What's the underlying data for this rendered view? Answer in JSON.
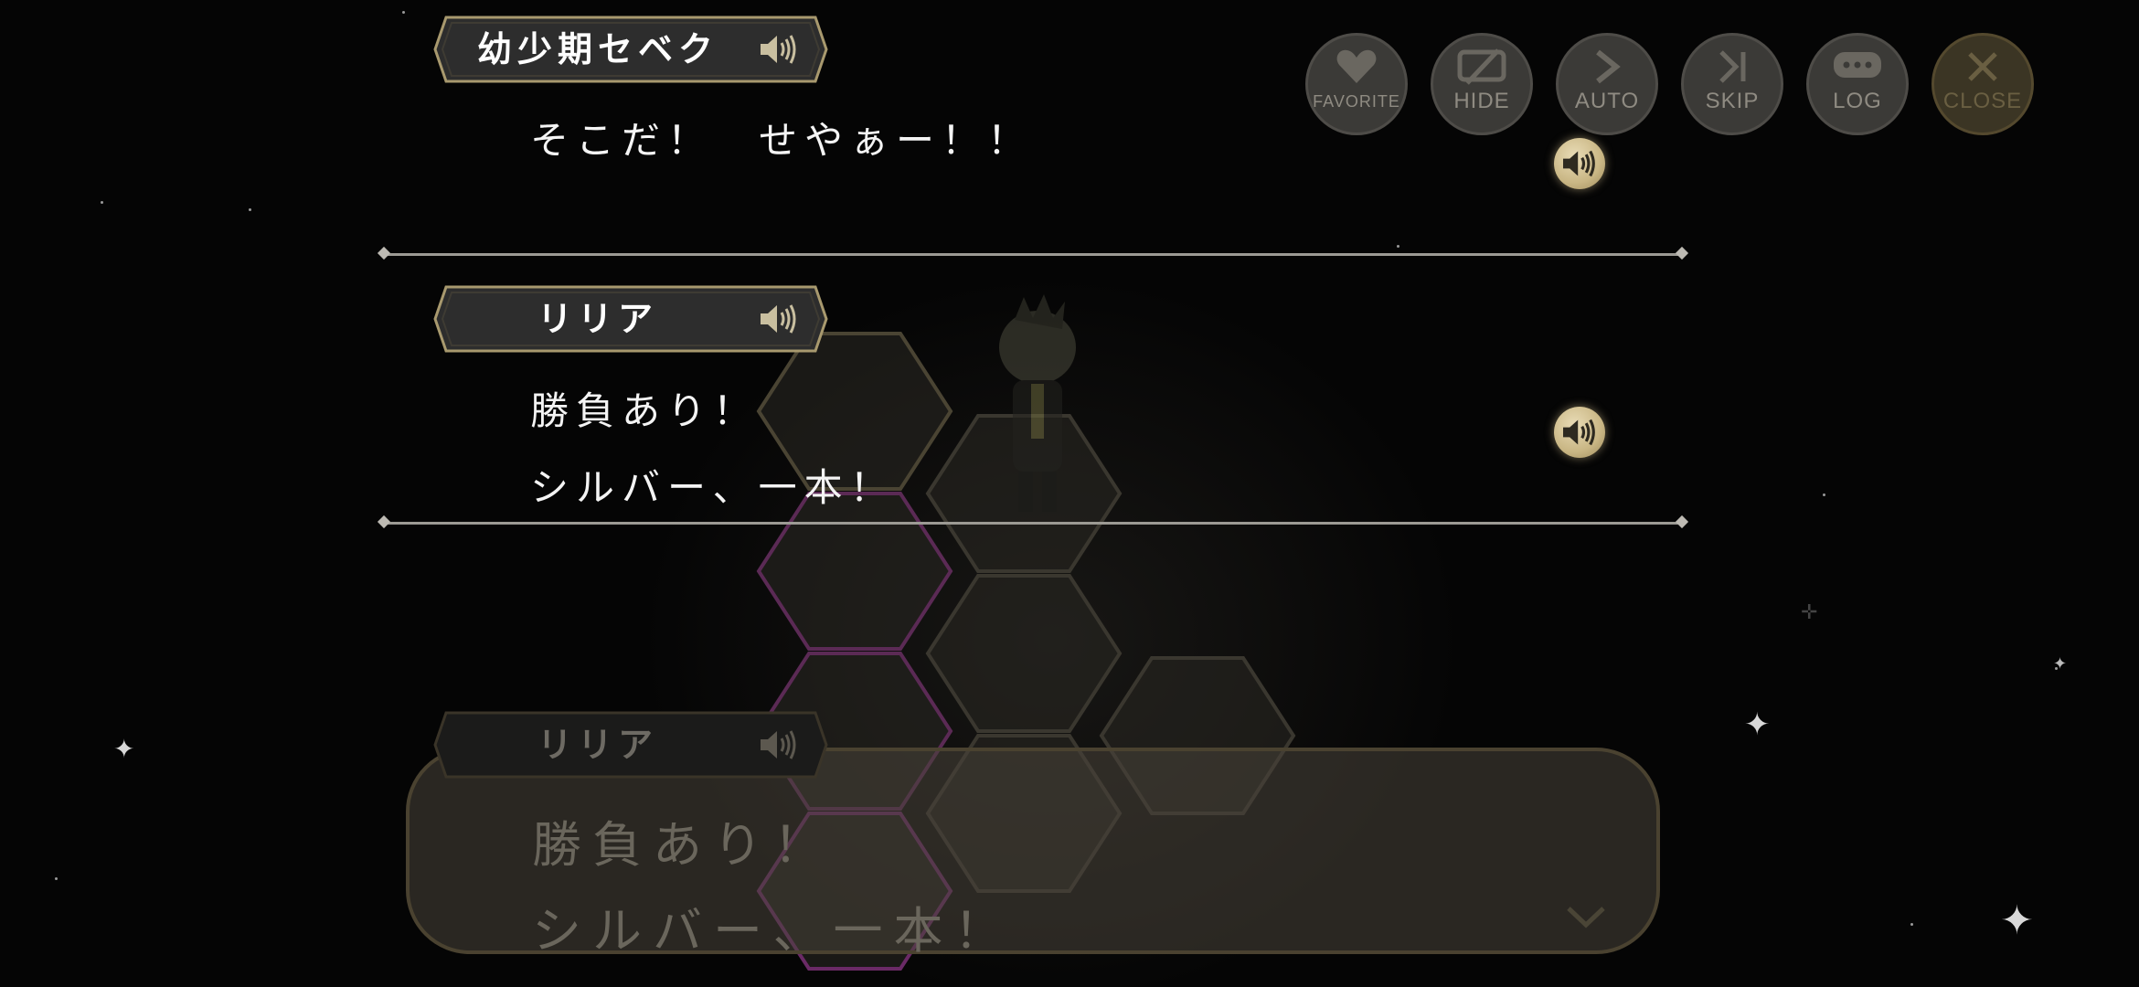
{
  "controls": [
    {
      "key": "favorite",
      "label": "FAVORITE",
      "icon": "heart-icon"
    },
    {
      "key": "hide",
      "label": "HIDE",
      "icon": "hide-icon"
    },
    {
      "key": "auto",
      "label": "AUTO",
      "icon": "play-arrow-icon"
    },
    {
      "key": "skip",
      "label": "SKIP",
      "icon": "skip-icon"
    },
    {
      "key": "log",
      "label": "LOG",
      "icon": "speech-bubble-icon"
    },
    {
      "key": "close",
      "label": "CLOSE",
      "icon": "close-icon"
    }
  ],
  "log": [
    {
      "speaker": "幼少期セベク",
      "lines": [
        "そこだ！　せやぁー！！"
      ]
    },
    {
      "speaker": "リリア",
      "lines": [
        "勝負あり！",
        "シルバー、一本！"
      ]
    }
  ],
  "dialogue": {
    "speaker": "リリア",
    "lines": [
      "勝負あり！",
      "シルバー、一本！"
    ]
  },
  "colors": {
    "gold": "#c9b684",
    "plate_border": "#a8996e",
    "button_bg": "#3b3a37"
  }
}
